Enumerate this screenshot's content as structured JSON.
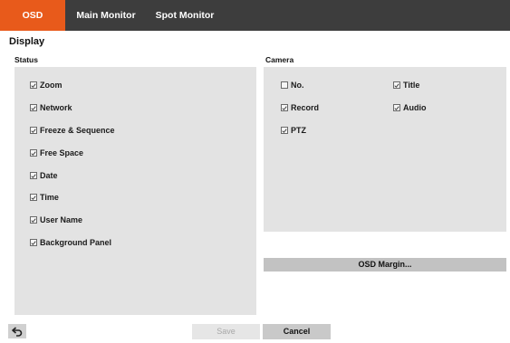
{
  "tabs": [
    {
      "label": "OSD",
      "active": true
    },
    {
      "label": "Main Monitor",
      "active": false
    },
    {
      "label": "Spot Monitor",
      "active": false
    }
  ],
  "section_title": "Display",
  "status": {
    "label": "Status",
    "items": [
      {
        "label": "Zoom",
        "checked": true
      },
      {
        "label": "Network",
        "checked": true
      },
      {
        "label": "Freeze & Sequence",
        "checked": true
      },
      {
        "label": "Free Space",
        "checked": true
      },
      {
        "label": "Date",
        "checked": true
      },
      {
        "label": "Time",
        "checked": true
      },
      {
        "label": "User Name",
        "checked": true
      },
      {
        "label": "Background Panel",
        "checked": true
      }
    ]
  },
  "camera": {
    "label": "Camera",
    "items": [
      {
        "label": "No.",
        "checked": false
      },
      {
        "label": "Title",
        "checked": true
      },
      {
        "label": "Record",
        "checked": true
      },
      {
        "label": "Audio",
        "checked": true
      },
      {
        "label": "PTZ",
        "checked": true
      }
    ]
  },
  "osd_margin_label": "OSD Margin...",
  "footer": {
    "back_icon": "back-arrow-icon",
    "save_label": "Save",
    "save_enabled": false,
    "cancel_label": "Cancel"
  },
  "colors": {
    "tabbar": "#3d3d3d",
    "active_tab": "#e85a1b",
    "panel": "#e3e3e3"
  }
}
